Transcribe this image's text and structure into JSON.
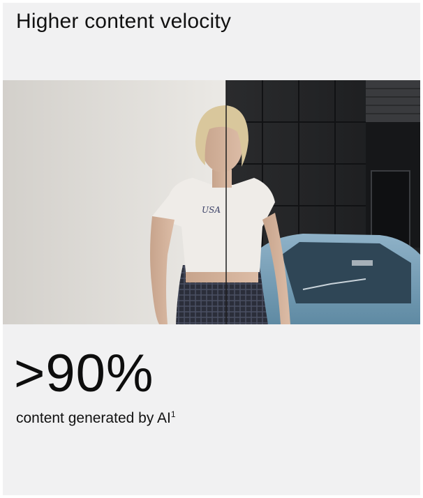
{
  "heading": "Higher content velocity",
  "stat": {
    "value": ">90%",
    "caption": "content generated by AI",
    "footnote_mark": "1"
  },
  "image": {
    "print_text": "USA"
  }
}
